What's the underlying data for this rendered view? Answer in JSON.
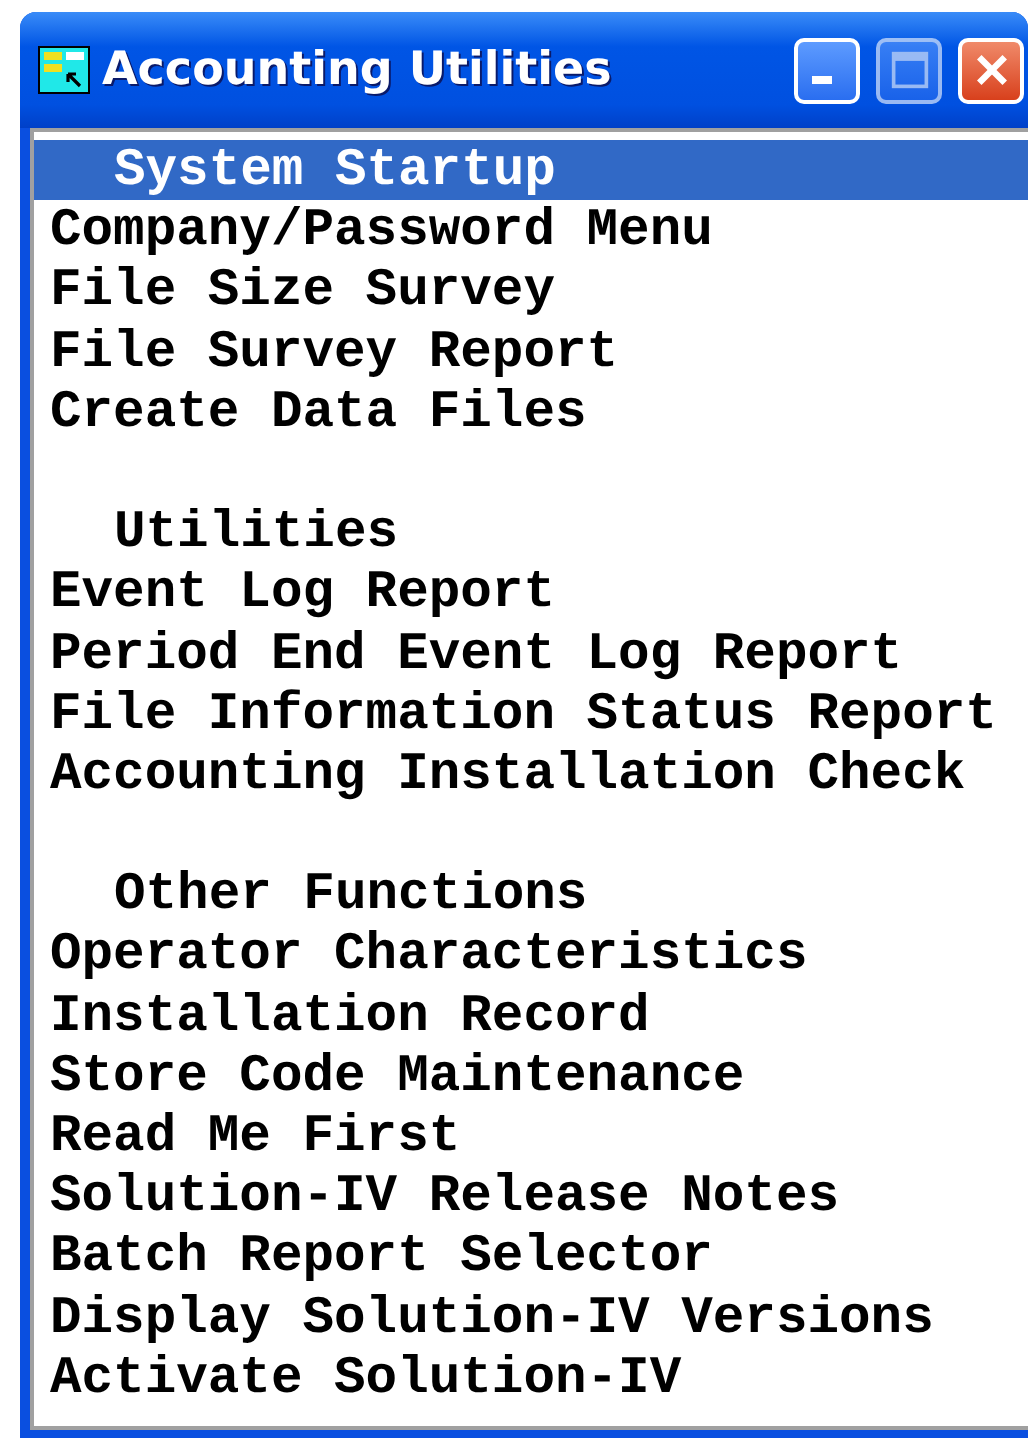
{
  "window": {
    "title": "Accounting Utilities"
  },
  "sections": [
    {
      "heading": {
        "label": "System Startup",
        "selected": true
      },
      "items": [
        {
          "label": "Company/Password Menu",
          "selected": false
        },
        {
          "label": "File Size Survey",
          "selected": false
        },
        {
          "label": "File Survey Report",
          "selected": false
        },
        {
          "label": "Create Data Files",
          "selected": false
        }
      ]
    },
    {
      "heading": {
        "label": "Utilities",
        "selected": false
      },
      "items": [
        {
          "label": "Event Log Report",
          "selected": false
        },
        {
          "label": "Period End Event Log Report",
          "selected": false
        },
        {
          "label": "File Information Status Report",
          "selected": false
        },
        {
          "label": "Accounting Installation Check",
          "selected": false
        }
      ]
    },
    {
      "heading": {
        "label": "Other Functions",
        "selected": false
      },
      "items": [
        {
          "label": "Operator Characteristics",
          "selected": false
        },
        {
          "label": "Installation Record",
          "selected": false
        },
        {
          "label": "Store Code Maintenance",
          "selected": false
        },
        {
          "label": "Read Me First",
          "selected": false
        },
        {
          "label": "Solution-IV Release Notes",
          "selected": false
        },
        {
          "label": "Batch Report Selector",
          "selected": false
        },
        {
          "label": "Display Solution-IV Versions",
          "selected": false
        },
        {
          "label": "Activate Solution-IV",
          "selected": false
        }
      ]
    }
  ]
}
